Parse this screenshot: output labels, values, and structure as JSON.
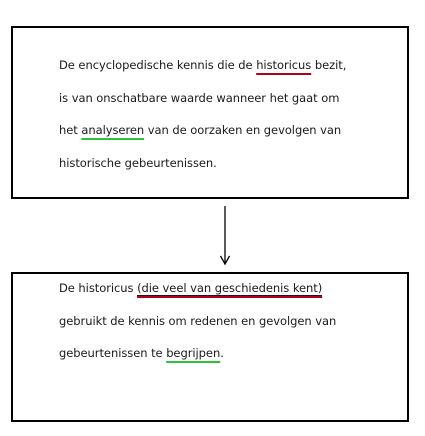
{
  "top_box": {
    "line1_pre": "De encyclopedische kennis die de ",
    "line1_mark": "historicus",
    "line1_post": " bezit,",
    "line2": "is van onschatbare waarde wanneer het gaat om",
    "line3_pre": "het ",
    "line3_mark": "analyseren",
    "line3_post": " van de oorzaken en gevolgen van",
    "line4": "historische gebeurtenissen."
  },
  "bottom_box": {
    "line1_pre": "De historicus ",
    "line1_mark": "(die veel van geschiedenis kent)",
    "line2": "gebruikt de kennis om redenen en gevolgen van",
    "line3_pre": "gebeurtenissen te ",
    "line3_mark": "begrijpen",
    "line3_post": "."
  },
  "colors": {
    "red_underline": "#b3001b",
    "green_underline": "#2ec23a",
    "border": "#000000"
  }
}
